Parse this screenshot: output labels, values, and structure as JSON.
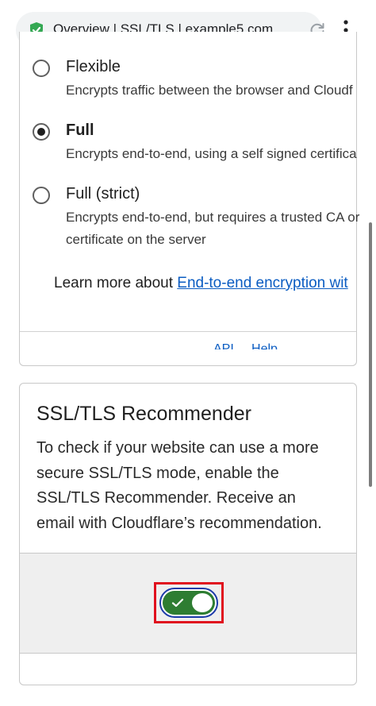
{
  "browser": {
    "url_text": "Overview | SSL/TLS | example5.com ...",
    "icons": [
      "shield-check-icon",
      "reload-icon",
      "more-vert-icon"
    ]
  },
  "ssl_options": [
    {
      "title": "Flexible",
      "description": [
        "Encrypts traffic between the browser and Cloudf"
      ],
      "checked": false
    },
    {
      "title": "Full",
      "description": [
        "Encrypts end-to-end, using a self signed certifica"
      ],
      "checked": true
    },
    {
      "title": "Full (strict)",
      "description": [
        "Encrypts end-to-end, but requires a trusted CA or",
        "certificate on the server"
      ],
      "checked": false
    }
  ],
  "learn_more": {
    "prefix": "Learn more about ",
    "link": "End-to-end encryption wit"
  },
  "clipped_link": "API ... Help",
  "recommender": {
    "title": "SSL/TLS Recommender",
    "body": [
      "To check if your website can use a more",
      "secure SSL/TLS mode, enable the",
      "SSL/TLS Recommender. Receive an",
      "email with Cloudflare’s recommendation."
    ],
    "toggle_on": true
  },
  "colors": {
    "link": "#0a5cc2",
    "toggle_on": "#2e7d32",
    "focus_ring": "#1c3aa9",
    "highlight": "#e0101e",
    "shield": "#34a853"
  }
}
